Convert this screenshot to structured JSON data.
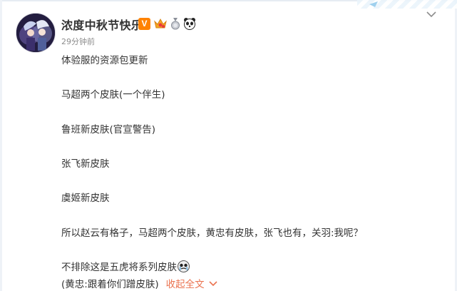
{
  "post": {
    "username": "浓度中秋节快乐",
    "verified_badge": "V",
    "time": "29分钟前",
    "lines": [
      "体验服的资源包更新",
      "马超两个皮肤(一个伴生)",
      "鲁班新皮肤(官宣警告)",
      "张飞新皮肤",
      "虞姬新皮肤",
      "所以赵云有格子，马超两个皮肤，黄忠有皮肤，张飞也有，关羽:我呢？",
      "不排除这是五虎将系列皮肤",
      "(黄忠:跟着你们蹭皮肤)"
    ],
    "collapse_label": "收起全文"
  },
  "icons": {
    "avatar": "avatar-image",
    "verified": "verified-v-icon",
    "crown": "crown-badge-icon",
    "medal": "medal-icon",
    "panda": "panda-icon",
    "menu": "chevron-down-icon",
    "emoji": "crying-emoji-icon",
    "collapse": "chevron-up-icon"
  },
  "colors": {
    "text": "#333333",
    "muted": "#8d8d8d",
    "accent": "#eb7350",
    "verified": "#ff8200"
  }
}
